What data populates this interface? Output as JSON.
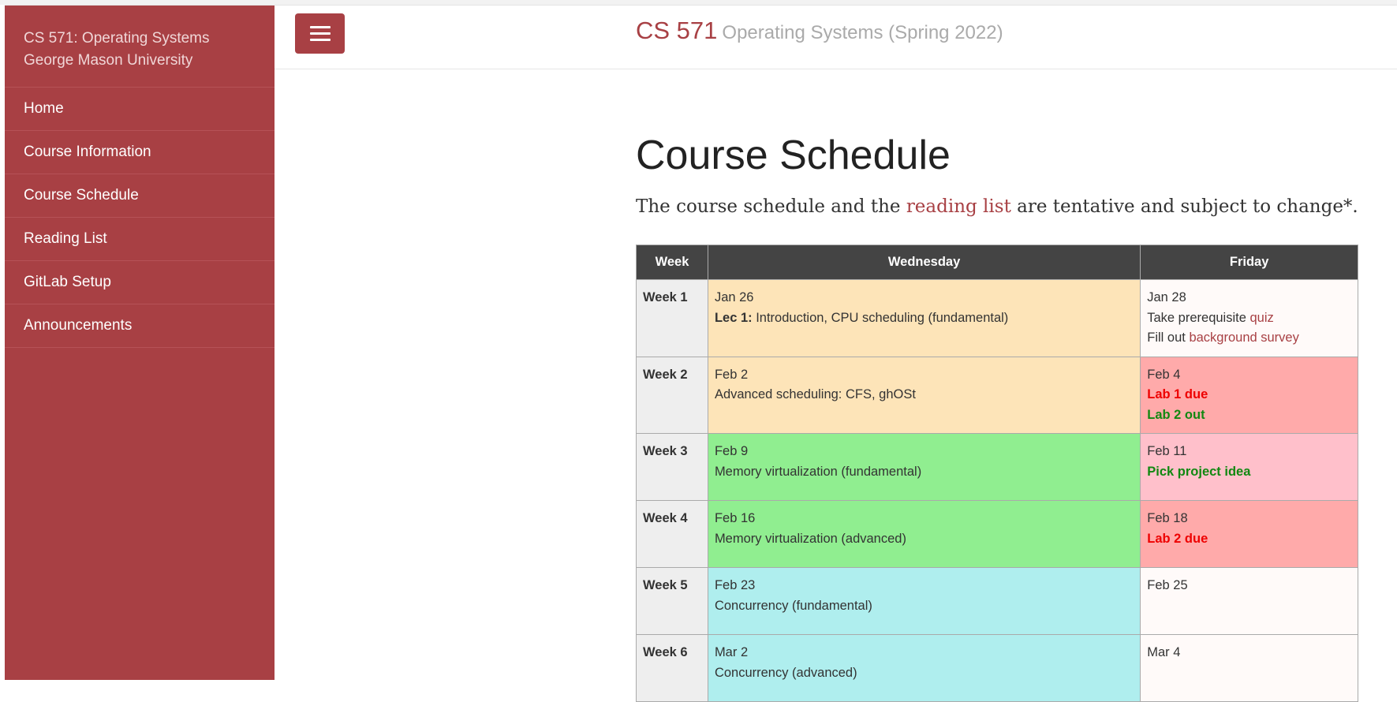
{
  "sidebar": {
    "header_line1": "CS 571: Operating Systems",
    "header_line2": "George Mason University",
    "items": [
      {
        "label": "Home"
      },
      {
        "label": "Course Information"
      },
      {
        "label": "Course Schedule"
      },
      {
        "label": "Reading List"
      },
      {
        "label": "GitLab Setup"
      },
      {
        "label": "Announcements"
      }
    ]
  },
  "header": {
    "course": "CS 571",
    "subtitle": "Operating Systems (Spring 2022)"
  },
  "main": {
    "title": "Course Schedule",
    "intro_before": "The course schedule and the ",
    "intro_link": "reading list",
    "intro_after": " are tentative and subject to change*."
  },
  "table": {
    "headers": [
      "Week",
      "Wednesday",
      "Friday"
    ],
    "rows": [
      {
        "week": "Week 1",
        "wed_date": "Jan 26",
        "wed_lec": "Lec 1:",
        "wed_text": " Introduction, CPU scheduling (fundamental)",
        "fri_date": "Jan 28",
        "fri_line1_text": "Take prerequisite ",
        "fri_line1_link": "quiz",
        "fri_line2_text": "Fill out ",
        "fri_line2_link": "background survey"
      },
      {
        "week": "Week 2",
        "wed_date": "Feb 2",
        "wed_text": "Advanced scheduling: CFS, ghOSt",
        "fri_date": "Feb 4",
        "fri_red": "Lab 1 due",
        "fri_green": "Lab 2 out"
      },
      {
        "week": "Week 3",
        "wed_date": "Feb 9",
        "wed_text": "Memory virtualization (fundamental)",
        "fri_date": "Feb 11",
        "fri_green": "Pick project idea"
      },
      {
        "week": "Week 4",
        "wed_date": "Feb 16",
        "wed_text": "Memory virtualization (advanced)",
        "fri_date": "Feb 18",
        "fri_red": "Lab 2 due"
      },
      {
        "week": "Week 5",
        "wed_date": "Feb 23",
        "wed_text": "Concurrency (fundamental)",
        "fri_date": "Feb 25"
      },
      {
        "week": "Week 6",
        "wed_date": "Mar 2",
        "wed_text": "Concurrency (advanced)",
        "fri_date": "Mar 4"
      }
    ]
  },
  "colors": {
    "brand": "#a84044",
    "orange_cell": "#fde4b8",
    "green_cell": "#90ee90",
    "cyan_cell": "#afeeee",
    "red_cell": "#ffaaaa",
    "pink_cell": "#ffc0cb"
  }
}
